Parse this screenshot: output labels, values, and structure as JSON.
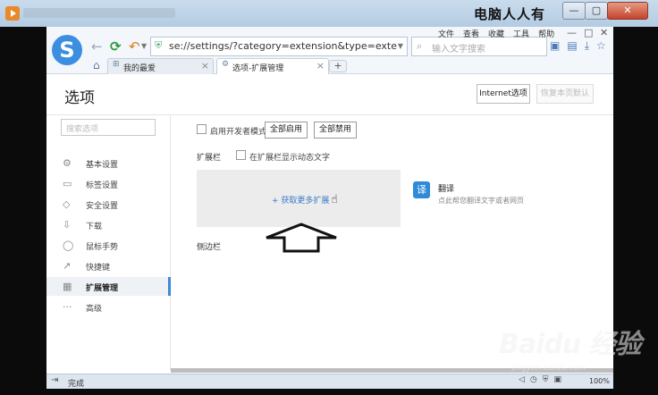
{
  "outer_window": {
    "watermark_text": "电脑人人有",
    "controls": {
      "minimize": "—",
      "maximize": "▢",
      "close": "✕"
    }
  },
  "browser": {
    "logo_letter": "S",
    "address": "se://settings/?category=extension&type=extensionbar",
    "search_placeholder": "输入文字搜索",
    "menu": [
      "文件",
      "查看",
      "收藏",
      "工具",
      "帮助"
    ],
    "window_controls": {
      "minimize": "—",
      "maximize": "□",
      "close": "✕"
    },
    "tabs": [
      {
        "label": "我的最爱",
        "close": "×"
      },
      {
        "label": "选项-扩展管理",
        "close": "×"
      }
    ],
    "new_tab": "+"
  },
  "settings": {
    "title": "选项",
    "internet_options": "Internet选项",
    "restore_defaults": "恢复本页默认",
    "search_placeholder": "搜索选项",
    "sidebar": [
      {
        "icon": "gear-icon",
        "glyph": "⚙",
        "label": "基本设置"
      },
      {
        "icon": "tab-icon",
        "glyph": "▭",
        "label": "标签设置"
      },
      {
        "icon": "shield-icon",
        "glyph": "◇",
        "label": "安全设置"
      },
      {
        "icon": "download-icon",
        "glyph": "⇩",
        "label": "下载"
      },
      {
        "icon": "mouse-icon",
        "glyph": "◯",
        "label": "鼠标手势"
      },
      {
        "icon": "shortcut-icon",
        "glyph": "↗",
        "label": "快捷键"
      },
      {
        "icon": "extensions-icon",
        "glyph": "▦",
        "label": "扩展管理",
        "active": true
      },
      {
        "icon": "more-icon",
        "glyph": "···",
        "label": "高级"
      }
    ],
    "dev_mode_label": "启用开发者模式",
    "enable_all": "全部启用",
    "disable_all": "全部禁用",
    "toolbar_heading": "扩展栏",
    "show_text_label": "在扩展栏显示动态文字",
    "get_more": "+ 获取更多扩展",
    "extension": {
      "icon_char": "译",
      "title": "翻译",
      "description": "点此帮您翻译文字或者网页"
    },
    "sidebar_heading": "侧边栏"
  },
  "status": {
    "text": "完成",
    "zoom": "100%"
  },
  "watermark": {
    "brand": "Baidu 经验",
    "url": "jingyan.baidu.com"
  }
}
